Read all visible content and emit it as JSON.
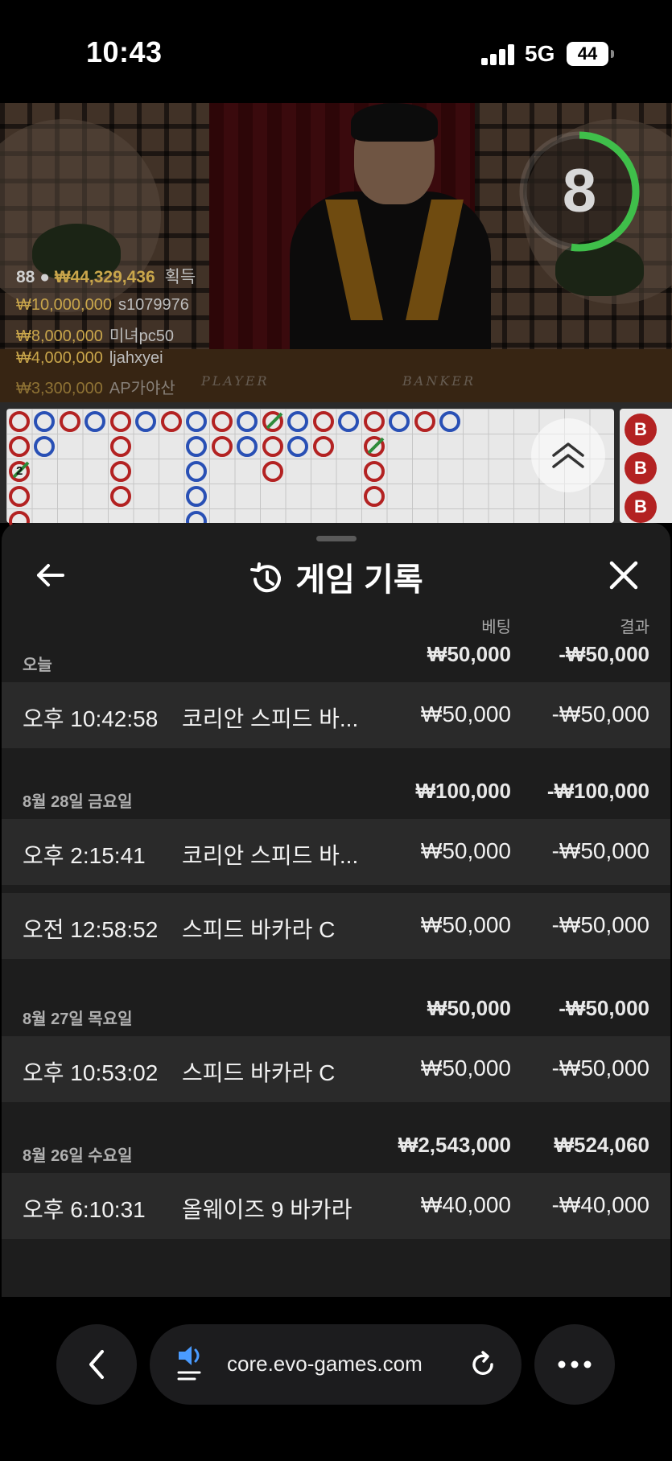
{
  "status_bar": {
    "time": "10:43",
    "network": "5G",
    "battery": "44"
  },
  "video": {
    "timer": "8",
    "player_count": "88",
    "total_won": "₩44,329,436",
    "total_won_label": "획득",
    "leaders": [
      {
        "amount": "₩10,000,000",
        "name": "s1079976"
      },
      {
        "amount": "₩8,000,000",
        "name": "미녀pc50"
      },
      {
        "amount": "₩4,000,000",
        "name": "ljahxyei"
      },
      {
        "amount": "₩3,300,000",
        "name": "AP가야산"
      }
    ],
    "table_text_left": "PLAYER",
    "table_text_right": "BANKER"
  },
  "roadmap": {
    "side_labels": [
      "B",
      "B",
      "B"
    ],
    "tie_count": "2"
  },
  "panel": {
    "title": "게임 기록",
    "col_bet": "베팅",
    "col_result": "결과",
    "groups": [
      {
        "date": "오늘",
        "bet_total": "₩50,000",
        "result_total": "-₩50,000",
        "rows": [
          {
            "time": "오후 10:42:58",
            "game": "코리안 스피드 바...",
            "bet": "₩50,000",
            "result": "-₩50,000"
          }
        ]
      },
      {
        "date": "8월 28일 금요일",
        "bet_total": "₩100,000",
        "result_total": "-₩100,000",
        "rows": [
          {
            "time": "오후 2:15:41",
            "game": "코리안 스피드 바...",
            "bet": "₩50,000",
            "result": "-₩50,000"
          },
          {
            "time": "오전 12:58:52",
            "game": "스피드 바카라 C",
            "bet": "₩50,000",
            "result": "-₩50,000"
          }
        ]
      },
      {
        "date": "8월 27일 목요일",
        "bet_total": "₩50,000",
        "result_total": "-₩50,000",
        "rows": [
          {
            "time": "오후 10:53:02",
            "game": "스피드 바카라 C",
            "bet": "₩50,000",
            "result": "-₩50,000"
          }
        ]
      },
      {
        "date": "8월 26일 수요일",
        "bet_total": "₩2,543,000",
        "result_total": "₩524,060",
        "rows": [
          {
            "time": "오후 6:10:31",
            "game": "올웨이즈 9 바카라",
            "bet": "₩40,000",
            "result": "-₩40,000"
          }
        ]
      }
    ]
  },
  "browser": {
    "url": "core.evo-games.com"
  },
  "colors": {
    "banker_red": "#b32222",
    "player_blue": "#2950b5",
    "tie_green": "#2e8b3a",
    "timer_green": "#3fbf4a",
    "panel_bg": "#1d1d1d"
  },
  "icons": [
    "back-arrow-icon",
    "history-icon",
    "close-icon",
    "chevron-up-icon",
    "speaker-icon",
    "reload-icon",
    "more-icon"
  ]
}
